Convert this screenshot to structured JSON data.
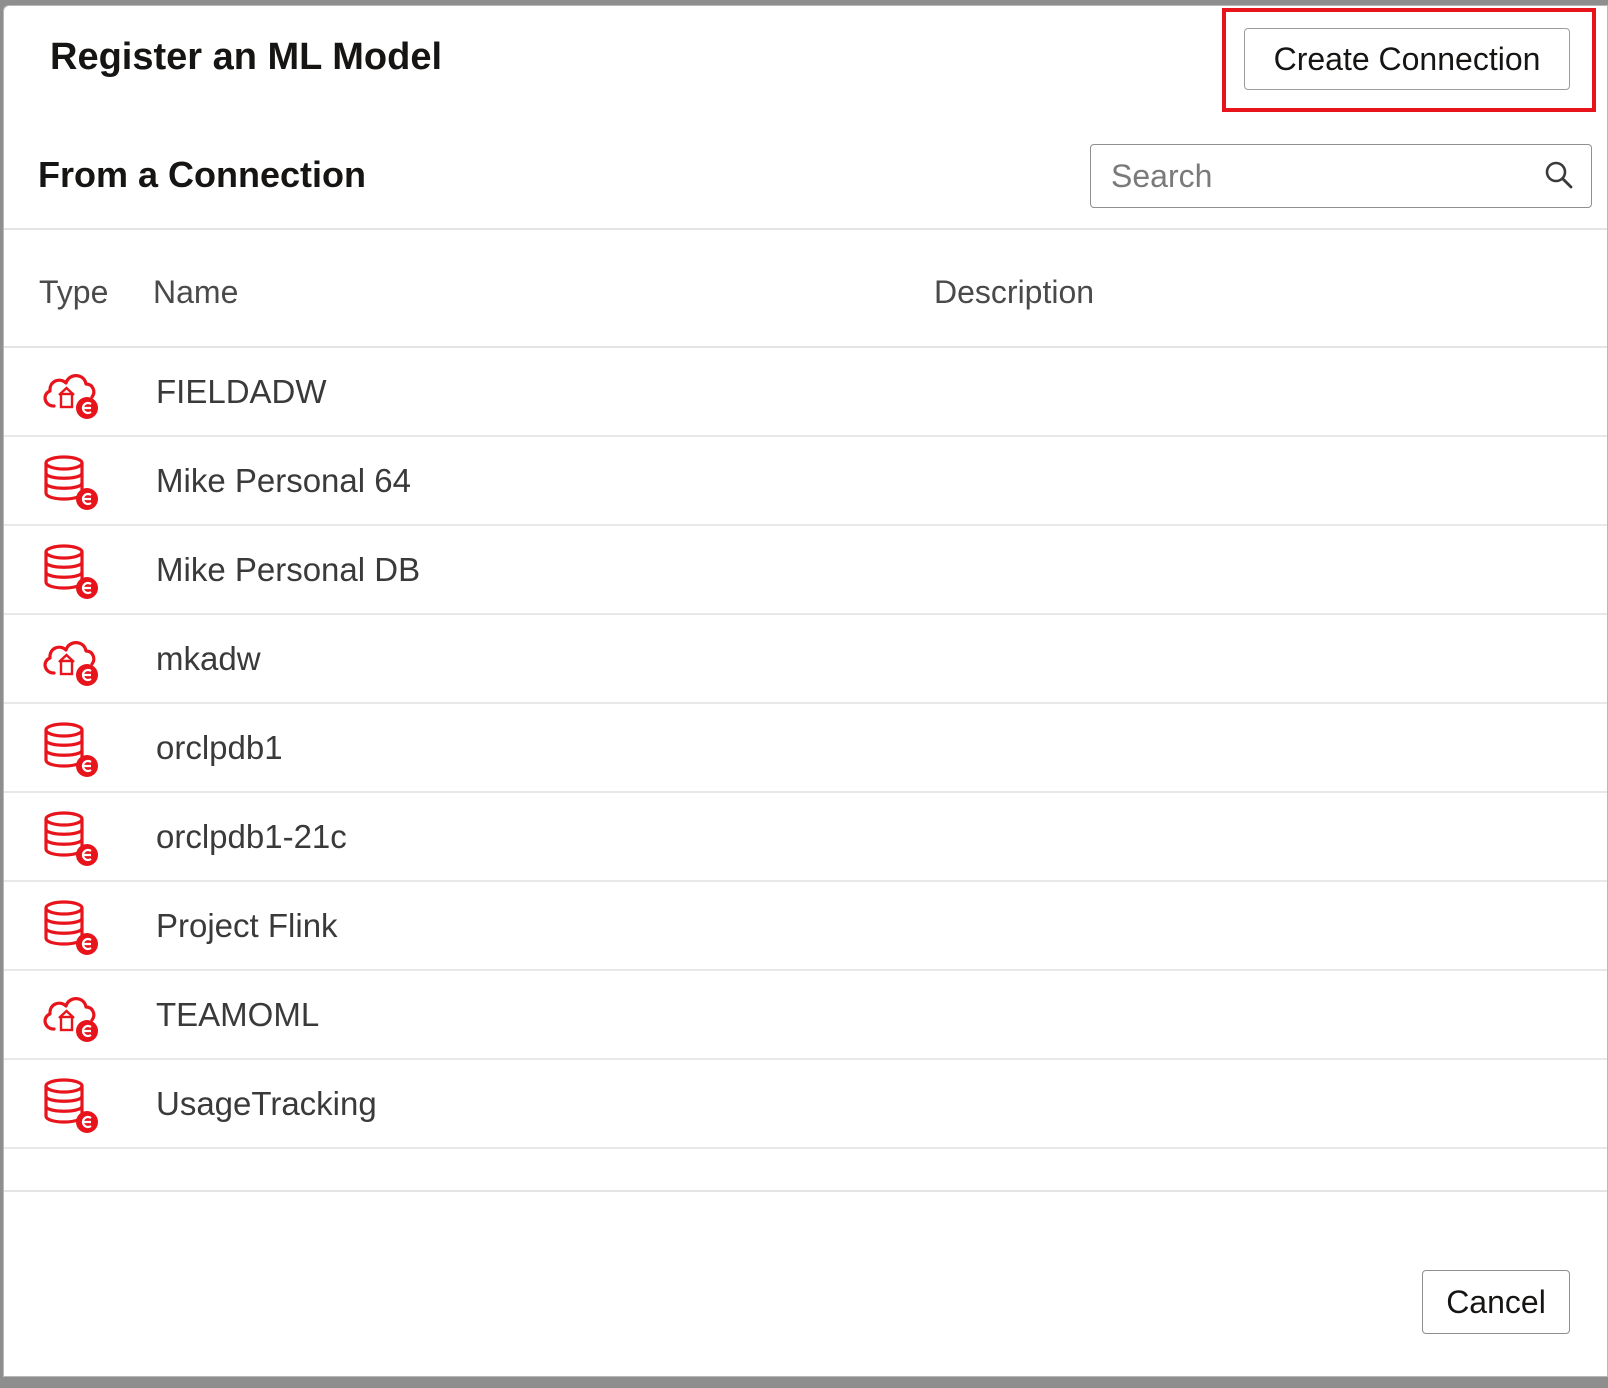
{
  "dialog": {
    "title": "Register an ML Model",
    "create_connection_label": "Create Connection",
    "subtitle": "From a Connection",
    "search_placeholder": "Search",
    "cancel_label": "Cancel"
  },
  "table": {
    "columns": [
      "Type",
      "Name",
      "Description"
    ],
    "rows": [
      {
        "type": "cloud-database",
        "name": "FIELDADW",
        "description": ""
      },
      {
        "type": "database",
        "name": "Mike Personal 64",
        "description": ""
      },
      {
        "type": "database",
        "name": "Mike Personal DB",
        "description": ""
      },
      {
        "type": "cloud-database",
        "name": "mkadw",
        "description": ""
      },
      {
        "type": "database",
        "name": "orclpdb1",
        "description": ""
      },
      {
        "type": "database",
        "name": "orclpdb1-21c",
        "description": ""
      },
      {
        "type": "database",
        "name": "Project Flink",
        "description": ""
      },
      {
        "type": "cloud-database",
        "name": "TEAMOML",
        "description": ""
      },
      {
        "type": "database",
        "name": "UsageTracking",
        "description": ""
      }
    ]
  },
  "colors": {
    "accent_red": "#e8141c",
    "text_primary": "#161513",
    "text_secondary": "#3a3a3a"
  }
}
